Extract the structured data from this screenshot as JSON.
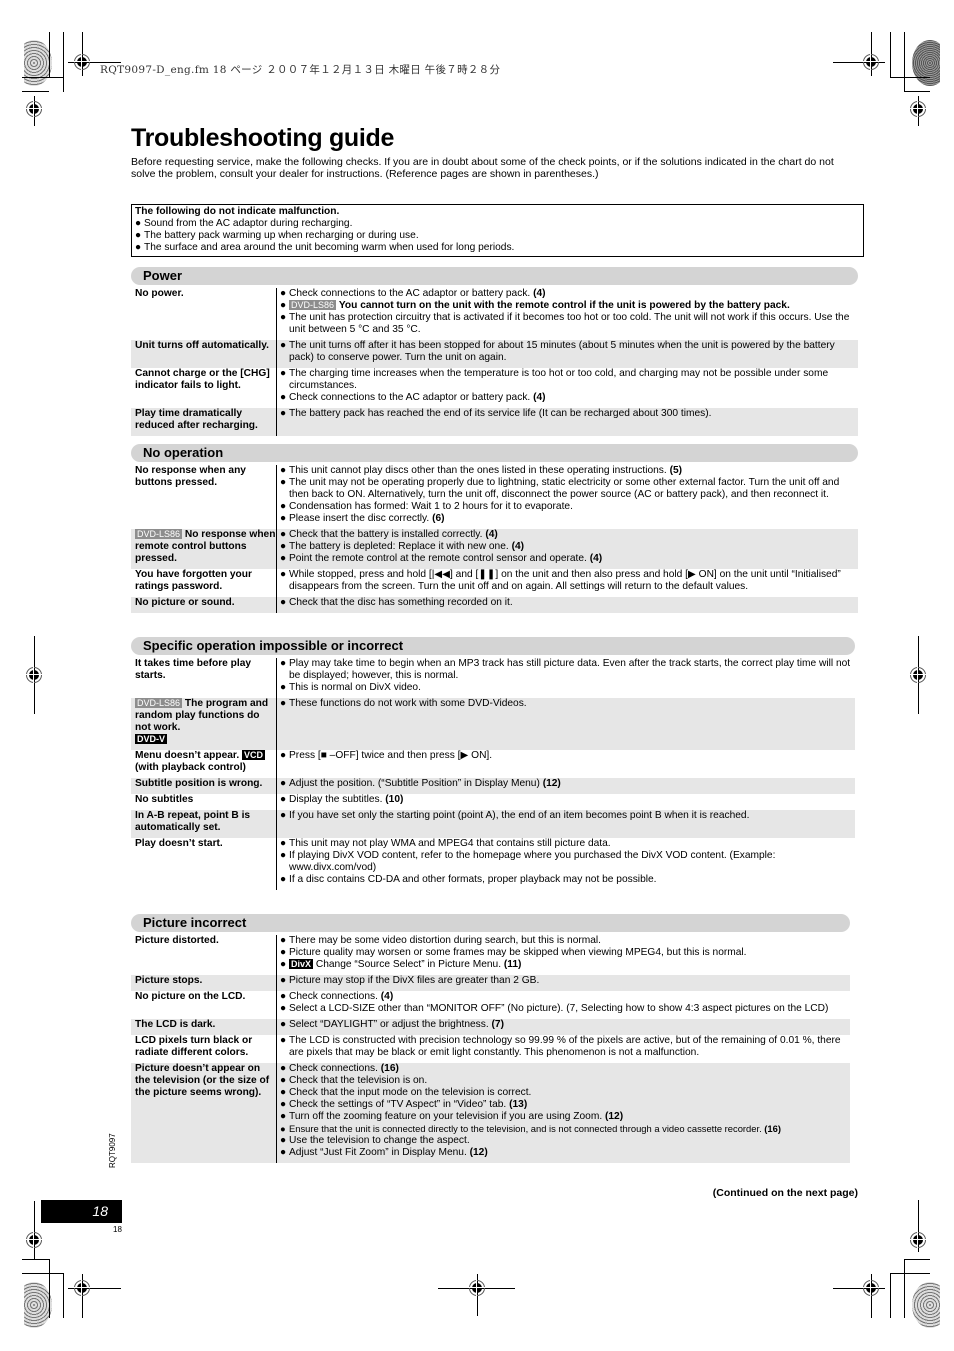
{
  "file_header": "RQT9097-D_eng.fm  18 ページ  ２００７年１２月１３日  木曜日  午後７時２８分",
  "title": "Troubleshooting guide",
  "intro": "Before requesting service, make the following checks. If you are in doubt about some of the check points, or if the solutions indicated in the chart do not solve the problem, consult your dealer for instructions. (Reference pages are shown in parentheses.)",
  "notice": {
    "heading": "The following do not indicate malfunction.",
    "items": [
      "Sound from the AC adaptor during recharging.",
      "The battery pack warming up when recharging or during use.",
      "The surface and area around the unit becoming warm when used for long periods."
    ]
  },
  "badges": {
    "dvd_ls86": "DVD-LS86",
    "dvd_v": "DVD-V",
    "vcd": "VCD",
    "divx": "DivX"
  },
  "bullet": "●",
  "sections": [
    {
      "title": "Power",
      "rows": [
        {
          "cause": "No power.",
          "solutions": [
            {
              "text": "Check connections to the AC adaptor or battery pack.",
              "ref": "(4)"
            },
            {
              "badge": "DVD-LS86",
              "bold": "You cannot turn on the unit with the remote control if the unit is powered by the battery pack."
            },
            {
              "text": "The unit has protection circuitry that is activated if it becomes too hot or too cold. The unit will not work if this occurs. Use the unit between 5 °C and 35 °C."
            }
          ]
        },
        {
          "cause": "Unit turns off automatically.",
          "solutions": [
            {
              "text": "The unit turns off after it has been stopped for about 15 minutes (about 5 minutes when the unit is powered by the battery pack) to conserve power. Turn the unit on again."
            }
          ]
        },
        {
          "cause": "Cannot charge or the [CHG] indicator fails to light.",
          "solutions": [
            {
              "text": "The charging time increases when the temperature is too hot or too cold, and charging may not be possible under some circumstances."
            },
            {
              "text": "Check connections to the AC adaptor or battery pack.",
              "ref": "(4)"
            }
          ]
        },
        {
          "cause": "Play time dramatically reduced after recharging.",
          "solutions": [
            {
              "text": "The battery pack has reached the end of its service life (It can be recharged about 300 times)."
            }
          ]
        }
      ]
    },
    {
      "title": "No operation",
      "rows": [
        {
          "cause": "No response when any buttons pressed.",
          "solutions": [
            {
              "text": "This unit cannot play discs other than the ones listed in these operating instructions.",
              "ref": "(5)"
            },
            {
              "text": "The unit may not be operating properly due to lightning, static electricity or some other external factor. Turn the unit off and then back to ON. Alternatively, turn the unit off, disconnect the power source (AC or battery pack), and then reconnect it."
            },
            {
              "text": "Condensation has formed: Wait 1 to 2 hours for it to evaporate."
            },
            {
              "text": "Please insert the disc correctly.",
              "ref": "(6)"
            }
          ]
        },
        {
          "cause_badge": "DVD-LS86",
          "cause": "No response when remote control buttons pressed.",
          "solutions": [
            {
              "text": "Check that the battery is installed correctly.",
              "ref": "(4)"
            },
            {
              "text": "The battery is depleted: Replace it with new one.",
              "ref": "(4)"
            },
            {
              "text": "Point the remote control at the remote control sensor and operate.",
              "ref": "(4)"
            }
          ]
        },
        {
          "cause": "You have forgotten your ratings password.",
          "solutions": [
            {
              "text": "While stopped, press and hold [|◀◀] and [❚❚] on the unit and then also press and hold [▶ ON] on the unit until “Initialised” disappears from the screen. Turn the unit off and on again. All settings will return to the default values."
            }
          ]
        },
        {
          "cause": "No picture or sound.",
          "solutions": [
            {
              "text": "Check that the disc has something recorded on it."
            }
          ]
        }
      ]
    },
    {
      "title": "Specific operation impossible or incorrect",
      "rows": [
        {
          "cause": "It takes time before play starts.",
          "solutions": [
            {
              "text": "Play may take time to begin when an MP3 track has still picture data. Even after the track starts, the correct play time will not be displayed; however, this is normal."
            },
            {
              "text": "This is normal on DivX video."
            }
          ]
        },
        {
          "cause_badge": "DVD-LS86",
          "cause": "The program and random play functions do not work.",
          "cause_badge_after": "DVD-V",
          "solutions": [
            {
              "text": "These functions do not work with some DVD-Videos."
            }
          ]
        },
        {
          "cause": "Menu doesn’t appear.",
          "cause_badge_inline": "VCD",
          "cause_after": "(with playback control)",
          "solutions": [
            {
              "text": "Press [■ –OFF] twice and then press [▶ ON]."
            }
          ]
        },
        {
          "cause": "Subtitle position is wrong.",
          "solutions": [
            {
              "text": "Adjust the position. (“Subtitle Position” in Display Menu)",
              "ref": "(12)"
            }
          ]
        },
        {
          "cause": "No subtitles",
          "solutions": [
            {
              "text": "Display the subtitles.",
              "ref": "(10)"
            }
          ]
        },
        {
          "cause": "In A-B repeat, point B is automatically set.",
          "solutions": [
            {
              "text": "If you have set only the starting point (point A), the end of an item becomes point B when it is reached."
            }
          ]
        },
        {
          "cause": "Play doesn’t start.",
          "solutions": [
            {
              "text": "This unit may not play WMA and MPEG4 that contains still picture data."
            },
            {
              "text": "If playing DivX VOD content, refer to the homepage where you purchased the DivX VOD content. (Example: www.divx.com/vod)"
            },
            {
              "text": "If a disc contains CD-DA and other formats, proper playback may not be possible."
            }
          ]
        }
      ]
    },
    {
      "title": "Picture incorrect",
      "rows": [
        {
          "cause": "Picture distorted.",
          "solutions": [
            {
              "text": "There may be some video distortion during search, but this is normal."
            },
            {
              "text": "Picture quality may worsen or some frames may be skipped when viewing MPEG4, but this is normal."
            },
            {
              "badge_black": "DivX",
              "text": "Change “Source Select” in Picture Menu.",
              "ref": "(11)"
            }
          ]
        },
        {
          "cause": "Picture stops.",
          "solutions": [
            {
              "text": "Picture may stop if the DivX files are greater than 2 GB."
            }
          ]
        },
        {
          "cause": "No picture on the LCD.",
          "solutions": [
            {
              "text": "Check connections.",
              "ref": "(4)"
            },
            {
              "text": "Select a LCD-SIZE other than “MONITOR OFF” (No picture). (7, Selecting how to show 4:3 aspect pictures on the LCD)"
            }
          ]
        },
        {
          "cause": "The LCD is dark.",
          "solutions": [
            {
              "text": "Select “DAYLIGHT” or adjust the brightness.",
              "ref": "(7)"
            }
          ]
        },
        {
          "cause": "LCD pixels turn black or radiate different colors.",
          "solutions": [
            {
              "text": "The LCD is constructed with precision technology so 99.99 % of the pixels are active, but of the remaining of 0.01 %, there are pixels that may be black or emit light constantly. This phenomenon is not a malfunction."
            }
          ]
        },
        {
          "cause": "Picture doesn’t appear on the television (or the size of the picture seems wrong).",
          "solutions": [
            {
              "text": "Check connections.",
              "ref": "(16)"
            },
            {
              "text": "Check that the television is on."
            },
            {
              "text": "Check that the input mode on the television is correct."
            },
            {
              "text": "Check the settings of “TV Aspect” in “Video” tab.",
              "ref": "(13)"
            },
            {
              "text": "Turn off the zooming feature on your television if you are using Zoom.",
              "ref": "(12)"
            },
            {
              "text": "Ensure that the unit is connected directly to the television, and is not connected through a video cassette recorder.",
              "ref": "(16)",
              "small": true
            },
            {
              "text": "Use the television to change the aspect."
            },
            {
              "text": "Adjust “Just Fit Zoom” in Display Menu.",
              "ref": "(12)"
            }
          ]
        }
      ]
    }
  ],
  "continued": "(Continued on the next page)",
  "page_number": "18",
  "page_number_small": "18",
  "doc_code": "RQT9097"
}
